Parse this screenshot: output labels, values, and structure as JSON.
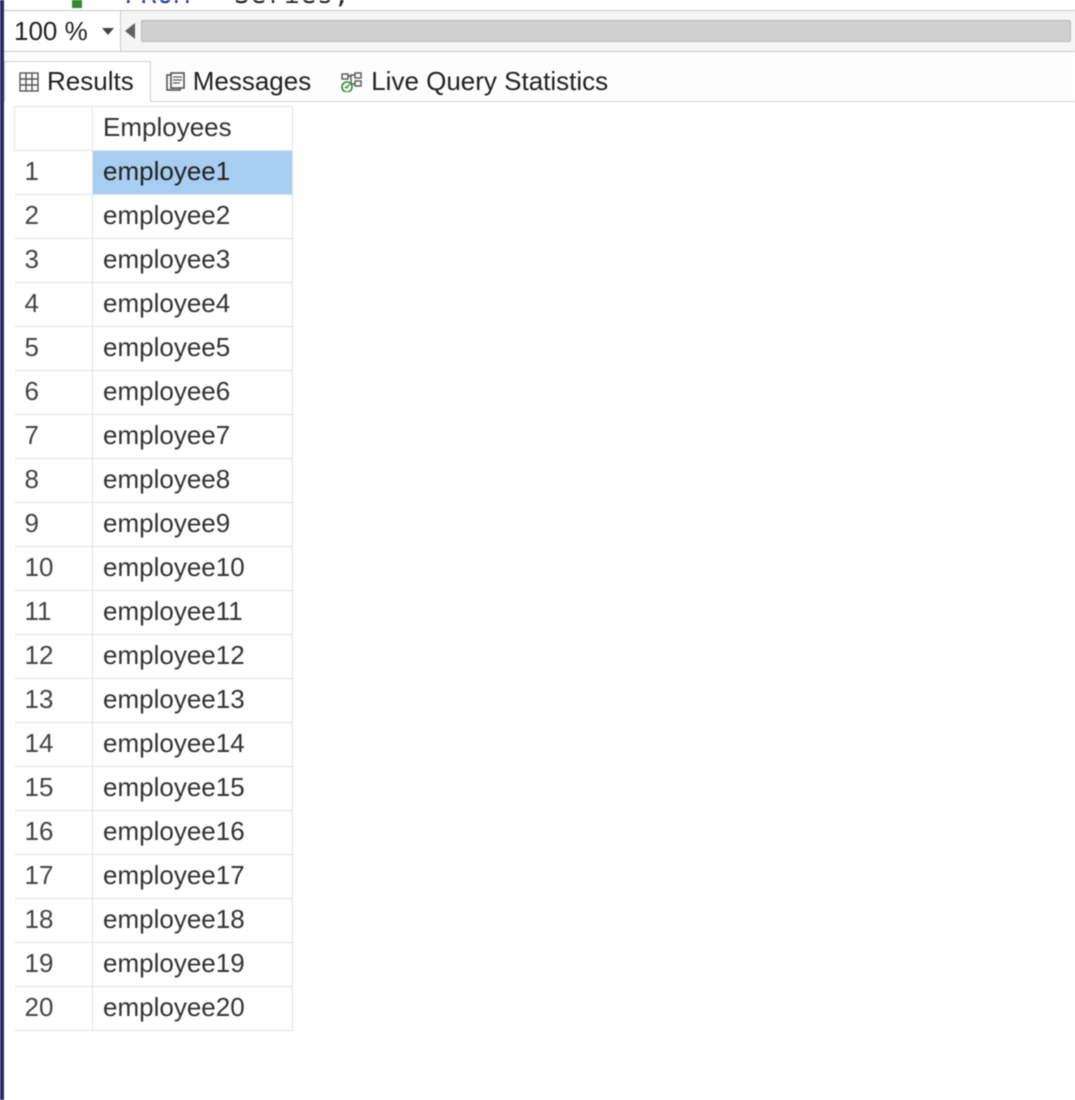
{
  "code_fragment": {
    "keyword": "FROM",
    "ident": "Series;"
  },
  "zoom": {
    "value": "100 %"
  },
  "tabs": {
    "results": "Results",
    "messages": "Messages",
    "live_stats": "Live Query Statistics",
    "active": "results"
  },
  "grid": {
    "column_header": "Employees",
    "rows": [
      {
        "n": "1",
        "value": "employee1"
      },
      {
        "n": "2",
        "value": "employee2"
      },
      {
        "n": "3",
        "value": "employee3"
      },
      {
        "n": "4",
        "value": "employee4"
      },
      {
        "n": "5",
        "value": "employee5"
      },
      {
        "n": "6",
        "value": "employee6"
      },
      {
        "n": "7",
        "value": "employee7"
      },
      {
        "n": "8",
        "value": "employee8"
      },
      {
        "n": "9",
        "value": "employee9"
      },
      {
        "n": "10",
        "value": "employee10"
      },
      {
        "n": "11",
        "value": "employee11"
      },
      {
        "n": "12",
        "value": "employee12"
      },
      {
        "n": "13",
        "value": "employee13"
      },
      {
        "n": "14",
        "value": "employee14"
      },
      {
        "n": "15",
        "value": "employee15"
      },
      {
        "n": "16",
        "value": "employee16"
      },
      {
        "n": "17",
        "value": "employee17"
      },
      {
        "n": "18",
        "value": "employee18"
      },
      {
        "n": "19",
        "value": "employee19"
      },
      {
        "n": "20",
        "value": "employee20"
      }
    ],
    "selected_index": 0
  }
}
